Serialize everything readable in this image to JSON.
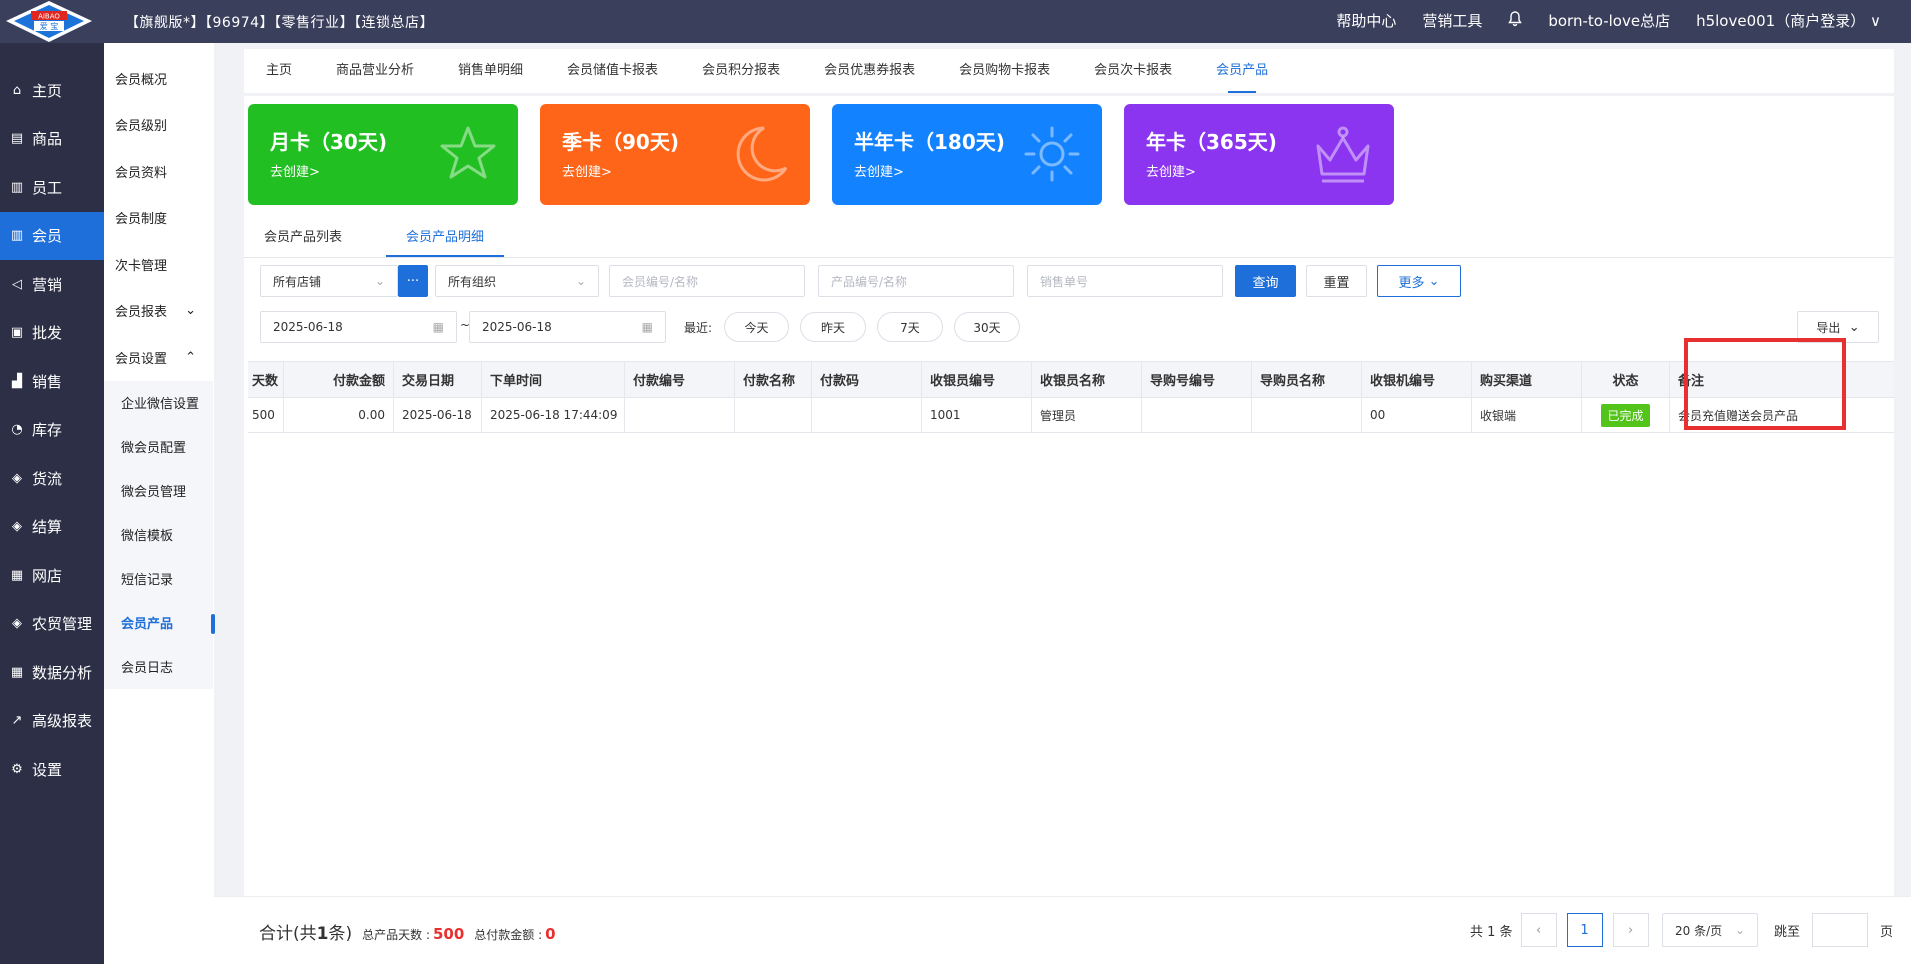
{
  "topbar": {
    "logo_text_top": "AIBAO",
    "logo_text_bottom": "爱 宝",
    "info": "【旗舰版*】【96974】【零售行业】【连锁总店】",
    "help": "帮助中心",
    "marketing_tools": "营销工具",
    "store": "born-to-love总店",
    "user": "h5love001（商户登录）"
  },
  "sidebar": {
    "items": [
      {
        "label": "主页",
        "icon": "home-icon"
      },
      {
        "label": "商品",
        "icon": "goods-icon"
      },
      {
        "label": "员工",
        "icon": "staff-icon"
      },
      {
        "label": "会员",
        "icon": "member-icon"
      },
      {
        "label": "营销",
        "icon": "megaphone-icon"
      },
      {
        "label": "批发",
        "icon": "wholesale-icon"
      },
      {
        "label": "销售",
        "icon": "sales-chart-icon"
      },
      {
        "label": "库存",
        "icon": "stock-icon"
      },
      {
        "label": "货流",
        "icon": "flow-icon"
      },
      {
        "label": "结算",
        "icon": "settle-icon"
      },
      {
        "label": "网店",
        "icon": "shop-icon"
      },
      {
        "label": "农贸管理",
        "icon": "farm-icon"
      },
      {
        "label": "数据分析",
        "icon": "data-icon"
      },
      {
        "label": "高级报表",
        "icon": "report-icon"
      },
      {
        "label": "设置",
        "icon": "gear-icon"
      }
    ]
  },
  "subnav": {
    "items": [
      "会员概况",
      "会员级别",
      "会员资料",
      "会员制度",
      "次卡管理"
    ],
    "group_report": "会员报表",
    "group_settings": "会员设置",
    "children": [
      "企业微信设置",
      "微会员配置",
      "微会员管理",
      "微信模板",
      "短信记录",
      "会员产品",
      "会员日志"
    ]
  },
  "tabs": [
    "主页",
    "商品营业分析",
    "销售单明细",
    "会员储值卡报表",
    "会员积分报表",
    "会员优惠券报表",
    "会员购物卡报表",
    "会员次卡报表",
    "会员产品"
  ],
  "cards": [
    {
      "title": "月卡（30天)",
      "sub": "去创建>",
      "color": "#22bf22"
    },
    {
      "title": "季卡（90天)",
      "sub": "去创建>",
      "color": "#ff6518"
    },
    {
      "title": "半年卡（180天)",
      "sub": "去创建>",
      "color": "#1282ff"
    },
    {
      "title": "年卡（365天)",
      "sub": "去创建>",
      "color": "#8c35f0"
    }
  ],
  "subtabs": [
    "会员产品列表",
    "会员产品明细"
  ],
  "filters": {
    "store": "所有店铺",
    "more_dots": "···",
    "org": "所有组织",
    "member_ph": "会员编号/名称",
    "product_ph": "产品编号/名称",
    "sale_ph": "销售单号",
    "query": "查询",
    "reset": "重置",
    "more": "更多",
    "date_from": "2025-06-18",
    "date_sep": "~",
    "date_to": "2025-06-18",
    "recent": "最近:",
    "today": "今天",
    "yesterday": "昨天",
    "d7": "7天",
    "d30": "30天",
    "export": "导出"
  },
  "table": {
    "headers": [
      "天数",
      "付款金额",
      "交易日期",
      "下单时间",
      "付款编号",
      "付款名称",
      "付款码",
      "收银员编号",
      "收银员名称",
      "导购号编号",
      "导购员名称",
      "收银机编号",
      "购买渠道",
      "状态",
      "备注"
    ],
    "rows": [
      [
        "500",
        "0.00",
        "2025-06-18",
        "2025-06-18 17:44:09",
        "",
        "",
        "",
        "1001",
        "管理员",
        "",
        "",
        "00",
        "收银端",
        "已完成",
        "会员充值赠送会员产品"
      ]
    ]
  },
  "footer": {
    "total_prefix": "合计(共",
    "total_count": "1",
    "total_suffix": "条)",
    "days_label": "总产品天数 :",
    "days_value": "500",
    "amount_label": "总付款金额 :",
    "amount_value": "0",
    "pager_total": "共 1 条",
    "current_page": "1",
    "page_size": "20 条/页",
    "jump": "跳至",
    "page_unit": "页"
  }
}
